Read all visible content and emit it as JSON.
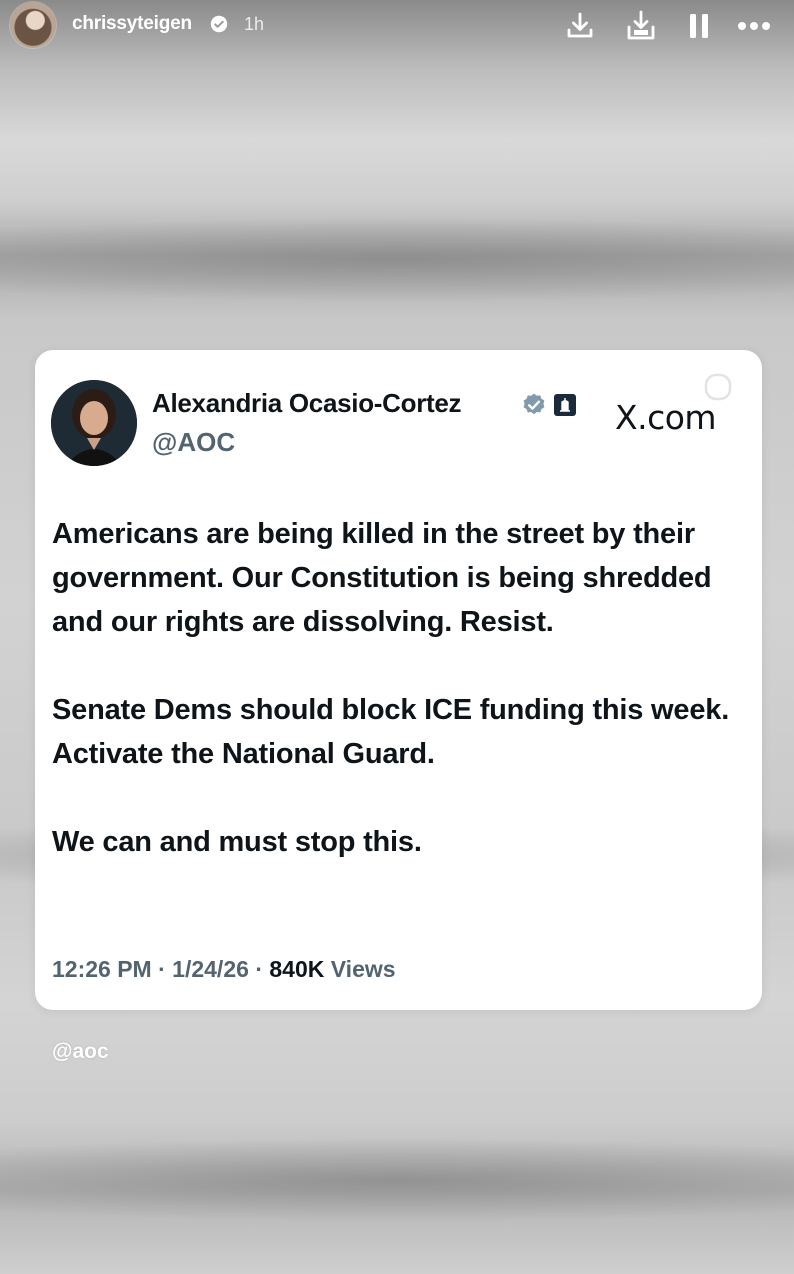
{
  "story": {
    "username": "chrissyteigen",
    "time_ago": "1h",
    "icons": [
      "download-icon",
      "save-icon",
      "pause-icon",
      "more-icon"
    ]
  },
  "tweet": {
    "author_name": "Alexandria Ocasio-Cortez",
    "handle": "@AOC",
    "source_label": "X.com",
    "paragraphs": [
      "Americans are being killed in the street by their government. Our Constitution is being shredded and our rights are dissolving. Resist.",
      "Senate Dems should block ICE funding this week. Activate the National Guard.",
      "We can and must stop this."
    ],
    "time": "12:26 PM",
    "date": "1/24/26",
    "views_count": "840K",
    "views_label": "Views",
    "separator": "·"
  },
  "mention": "@aoc",
  "colors": {
    "card_background": "#ffffff",
    "text_primary": "#0f1419",
    "text_secondary": "#536471",
    "header_text": "#ffffff"
  }
}
